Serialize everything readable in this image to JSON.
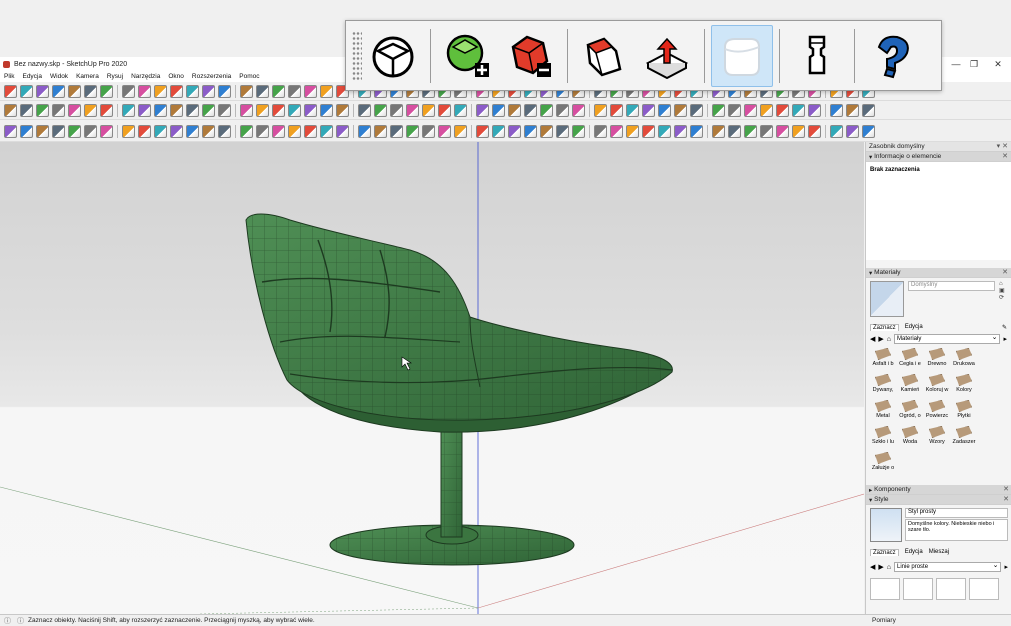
{
  "window": {
    "title": "Bez nazwy.skp - SketchUp Pro 2020",
    "min": "—",
    "max": "❐",
    "close": "✕"
  },
  "menu": [
    "Plik",
    "Edycja",
    "Widok",
    "Kamera",
    "Rysuj",
    "Narzędzia",
    "Okno",
    "Rozszerzenia",
    "Pomoc"
  ],
  "floating_toolbar": {
    "buttons": [
      "solid-outer-shell",
      "union",
      "subtract",
      "intersect",
      "push-pull",
      "active-soft",
      "trim",
      "help"
    ]
  },
  "panel": {
    "title": "Zasobnik domyślny",
    "entity_info": {
      "header": "Informacje o elemencie",
      "selection": "Brak zaznaczenia"
    },
    "materials": {
      "header": "Materiały",
      "current": "Domyślny",
      "tabs": [
        "Zaznacz",
        "Edycja"
      ],
      "collection": "Materiały",
      "items": [
        "Asfalt i b",
        "Cegła i e",
        "Drewno",
        "Drukowa",
        "Dywany,",
        "Kamień",
        "Koloruj w",
        "Kolory",
        "Metal",
        "Ogród, o",
        "Powierzc",
        "Płytki",
        "Szkło i lu",
        "Woda",
        "Wzory",
        "Zadaszer",
        "Załużje o"
      ]
    },
    "components": {
      "header": "Komponenty"
    },
    "styles": {
      "header": "Style",
      "name": "Styl prosty",
      "description": "Domyślne kolory. Niebieskie niebo i szare tło.",
      "tabs": [
        "Zaznacz",
        "Edycja",
        "Mieszaj"
      ],
      "collection": "Linie proste"
    }
  },
  "status": {
    "text": "Zaznacz obiekty. Naciśnij Shift, aby rozszerzyć zaznaczenie. Przeciągnij myszką, aby wybrać wiele.",
    "measurements_label": "Pomiary"
  },
  "colors": {
    "chair": "#3f7a45",
    "chair_lines": "#1d3a20",
    "accent": "#1a73c7"
  }
}
